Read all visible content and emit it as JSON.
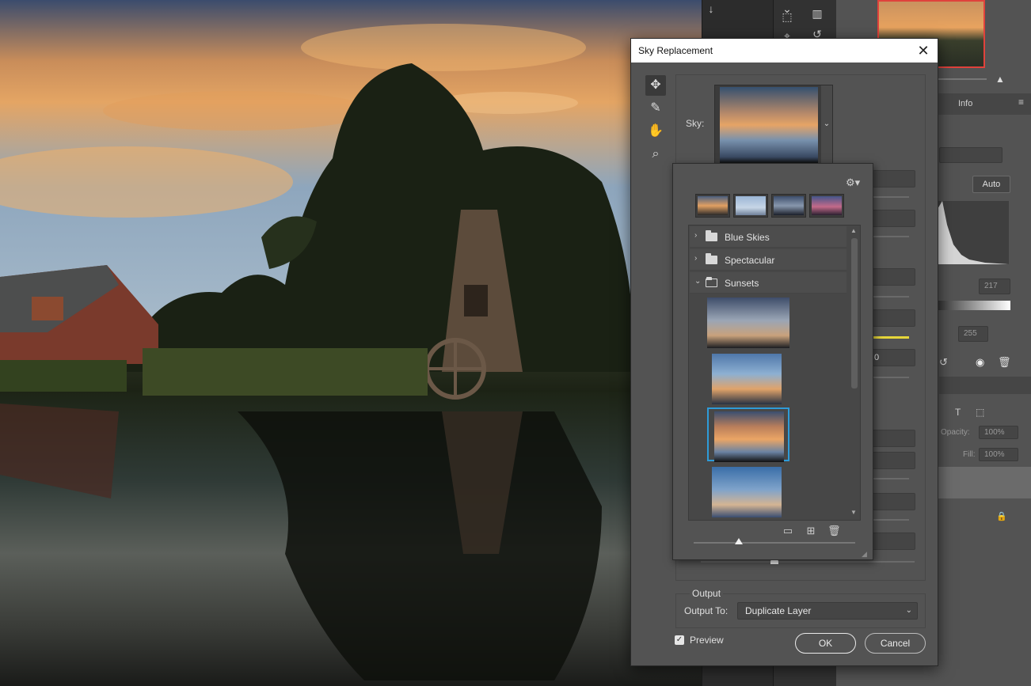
{
  "dialog": {
    "title": "Sky Replacement",
    "close_icon": "close-icon",
    "tools": [
      "move-sky-icon",
      "sky-brush-icon",
      "hand-icon",
      "zoom-icon"
    ],
    "sky_label": "Sky:",
    "output": {
      "legend": "Output",
      "output_to_label": "Output To:",
      "output_to_value": "Duplicate Layer"
    },
    "preview_label": "Preview",
    "preview_checked": true,
    "ok_label": "OK",
    "cancel_label": "Cancel"
  },
  "sky_picker": {
    "folders": [
      {
        "name": "Blue Skies",
        "expanded": false
      },
      {
        "name": "Spectacular",
        "expanded": false
      },
      {
        "name": "Sunsets",
        "expanded": true
      }
    ],
    "selected_index": 2
  },
  "right_panel": {
    "tab_info": "Info",
    "auto_button": "Auto",
    "level_mid": "217",
    "level_out": "255",
    "opacity_label": "Opacity:",
    "opacity_value": "100%",
    "fill_label": "Fill:",
    "fill_value": "100%",
    "side_zero": "0"
  },
  "colors": {
    "accent_selection": "#2e9bd8",
    "dialog_bg": "#535353",
    "titlebar_bg": "#ffffff"
  }
}
